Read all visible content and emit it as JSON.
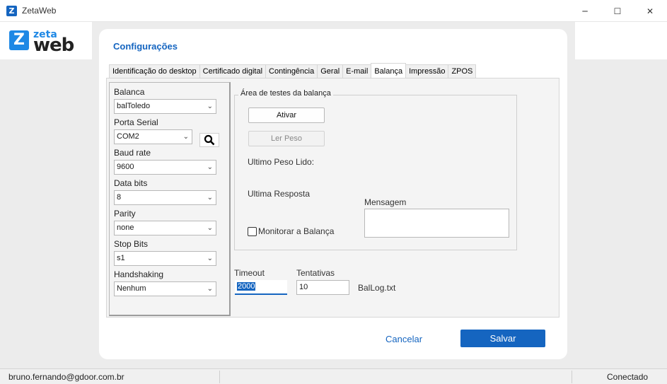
{
  "window": {
    "title": "ZetaWeb",
    "app_icon": "Z",
    "minimize_icon": "─",
    "maximize_icon": "☐",
    "close_icon": "✕"
  },
  "logo": {
    "mark": "Z",
    "top": "zeta",
    "bottom": "web"
  },
  "dialog": {
    "title": "Configurações",
    "tabs": [
      {
        "label": "Identificação do desktop",
        "active": false
      },
      {
        "label": "Certificado digital",
        "active": false
      },
      {
        "label": "Contingência",
        "active": false
      },
      {
        "label": "Geral",
        "active": false
      },
      {
        "label": "E-mail",
        "active": false
      },
      {
        "label": "Balança",
        "active": true
      },
      {
        "label": "Impressão",
        "active": false
      },
      {
        "label": "ZPOS",
        "active": false
      }
    ],
    "fields": {
      "balanca": {
        "label": "Balanca",
        "value": "balToledo"
      },
      "porta_serial": {
        "label": "Porta Serial",
        "value": "COM2"
      },
      "baud_rate": {
        "label": "Baud rate",
        "value": "9600"
      },
      "data_bits": {
        "label": "Data bits",
        "value": "8"
      },
      "parity": {
        "label": "Parity",
        "value": "none"
      },
      "stop_bits": {
        "label": "Stop Bits",
        "value": "s1"
      },
      "handshaking": {
        "label": "Handshaking",
        "value": "Nenhum"
      }
    },
    "test_area": {
      "legend": "Área de testes da balança",
      "activate_label": "Ativar",
      "read_weight_label": "Ler Peso",
      "last_weight_label": "Ultimo Peso Lido:",
      "last_response_label": "Ultima Resposta",
      "message_label": "Mensagem",
      "message_value": "",
      "monitor_label": "Monitorar a Balança",
      "monitor_checked": false
    },
    "timeout": {
      "label": "Timeout",
      "value": "2000"
    },
    "attempts": {
      "label": "Tentativas",
      "value": "10"
    },
    "log_file": "BalLog.txt",
    "cancel_label": "Cancelar",
    "save_label": "Salvar"
  },
  "status": {
    "user": "bruno.fernando@gdoor.com.br",
    "connection": "Conectado"
  },
  "colors": {
    "accent": "#1565c0",
    "logo_blue": "#1e88e5"
  }
}
